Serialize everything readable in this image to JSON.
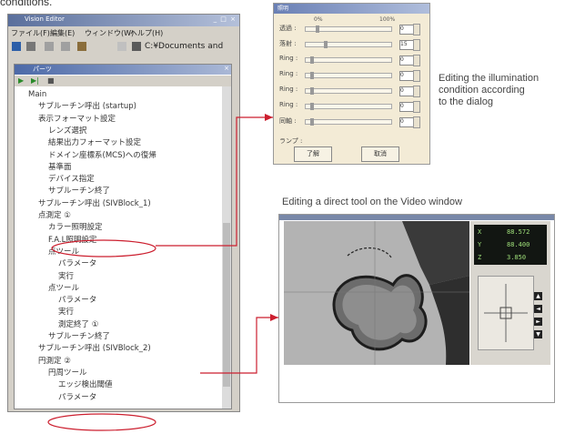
{
  "caption_top": "conditions.",
  "app": {
    "title": "Vision Editor",
    "window_buttons": "_ □ ×",
    "menu": [
      "ファイル(F)",
      "編集(E)",
      "ウィンドウ(W)",
      "ヘルプ(H)"
    ],
    "path": "C:¥Documents and",
    "inner_title": "パーツ"
  },
  "tree": [
    {
      "label": "Main",
      "indent": 1
    },
    {
      "label": "サブルーチン呼出 (startup)",
      "indent": 2
    },
    {
      "label": "表示フォーマット設定",
      "indent": 2
    },
    {
      "label": "レンズ選択",
      "indent": 3
    },
    {
      "label": "結果出力フォーマット設定",
      "indent": 3
    },
    {
      "label": "ドメイン座標系(MCS)への復帰",
      "indent": 3
    },
    {
      "label": "基準面",
      "indent": 3
    },
    {
      "label": "デバイス指定",
      "indent": 3
    },
    {
      "label": "サブルーチン終了",
      "indent": 3
    },
    {
      "label": "サブルーチン呼出 (SIVBlock_1)",
      "indent": 2
    },
    {
      "label": "点測定 ①",
      "indent": 2
    },
    {
      "label": "カラー照明設定",
      "indent": 3
    },
    {
      "label": "F.A.L照明設定",
      "indent": 3
    },
    {
      "label": "点ツール",
      "indent": 3
    },
    {
      "label": "パラメータ",
      "indent": 4
    },
    {
      "label": "実行",
      "indent": 4
    },
    {
      "label": "点ツール",
      "indent": 3
    },
    {
      "label": "パラメータ",
      "indent": 4
    },
    {
      "label": "実行",
      "indent": 4
    },
    {
      "label": "測定終了 ①",
      "indent": 4
    },
    {
      "label": "サブルーチン終了",
      "indent": 3
    },
    {
      "label": "サブルーチン呼出 (SIVBlock_2)",
      "indent": 2
    },
    {
      "label": "円測定 ②",
      "indent": 2
    },
    {
      "label": "円周ツール",
      "indent": 3
    },
    {
      "label": "エッジ検出閾値",
      "indent": 4
    },
    {
      "label": "パラメータ",
      "indent": 4
    }
  ],
  "dialog": {
    "title": "照明",
    "scale_min": "0%",
    "scale_max": "100%",
    "rows": [
      {
        "label": "透過 :",
        "value": "0",
        "level": 0.12
      },
      {
        "label": "落射 :",
        "value": "15",
        "level": 0.22
      },
      {
        "label": "Ring :",
        "value": "0",
        "level": 0.05
      },
      {
        "label": "Ring :",
        "value": "0",
        "level": 0.05
      },
      {
        "label": "Ring :",
        "value": "0",
        "level": 0.05
      },
      {
        "label": "Ring :",
        "value": "0",
        "level": 0.05
      },
      {
        "label": "同軸 :",
        "value": "0",
        "level": 0.05
      }
    ],
    "lamp_label": "ランプ :",
    "ok_label": "了解",
    "cancel_label": "取消"
  },
  "caption_illumination": [
    "Editing the illumination",
    "condition according",
    "to the dialog"
  ],
  "caption_video": "Editing a direct tool on the Video window",
  "video": {
    "readout": [
      "X",
      "Y",
      "Z"
    ],
    "readout_values": [
      "88.572",
      "88.400",
      "3.850"
    ],
    "stage_buttons": [
      "▲",
      "◄",
      "►",
      "▼"
    ]
  },
  "accent_color": "#cc1f2f"
}
